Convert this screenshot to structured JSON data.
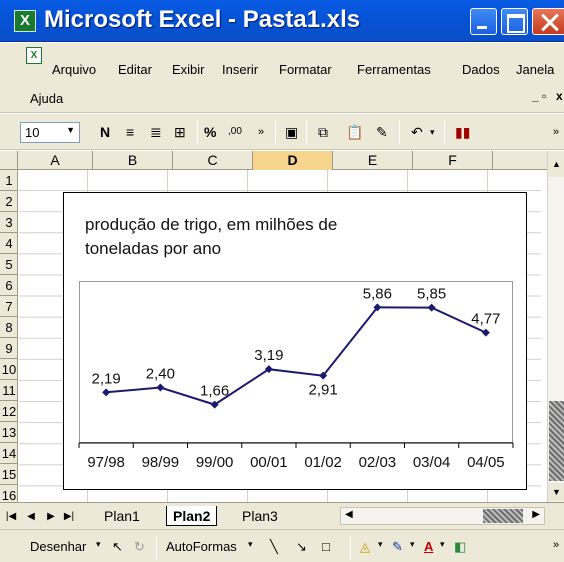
{
  "window": {
    "title": "Microsoft Excel - Pasta1.xls",
    "app_icon": "excel-logo-icon"
  },
  "menu": {
    "items": [
      "Arquivo",
      "Editar",
      "Exibir",
      "Inserir",
      "Formatar",
      "Ferramentas",
      "Dados",
      "Janela",
      "Ajuda"
    ]
  },
  "toolbar": {
    "font_size": "10",
    "bold": "N",
    "icons": [
      "align-left-icon",
      "align-center-icon",
      "merge-center-icon",
      "percent-icon",
      "increase-decimal-icon",
      "save-icon",
      "copy-icon",
      "paste-icon",
      "format-painter-icon",
      "undo-icon",
      "chart-wizard-icon"
    ],
    "percent": "%",
    "decimal": ",00"
  },
  "grid": {
    "columns": [
      "A",
      "B",
      "C",
      "D",
      "E",
      "F"
    ],
    "active_column": "D",
    "rows": [
      "1",
      "2",
      "3",
      "4",
      "5",
      "6",
      "7",
      "8",
      "9",
      "10",
      "11",
      "12",
      "13",
      "14",
      "15",
      "16"
    ]
  },
  "chart_data": {
    "type": "line",
    "title": "produção de trigo, em milhões de toneladas por ano",
    "categories": [
      "97/98",
      "98/99",
      "99/00",
      "00/01",
      "01/02",
      "02/03",
      "03/04",
      "04/05"
    ],
    "values": [
      2.19,
      2.4,
      1.66,
      3.19,
      2.91,
      5.86,
      5.85,
      4.77
    ],
    "data_labels": [
      "2,19",
      "2,40",
      "1,66",
      "3,19",
      "2,91",
      "5,86",
      "5,85",
      "4,77"
    ],
    "xlabel": "",
    "ylabel": "",
    "ylim": [
      0,
      7
    ],
    "grid": false,
    "legend": "none",
    "line_color": "#1a1a6e"
  },
  "sheets": {
    "tabs": [
      "Plan1",
      "Plan2",
      "Plan3"
    ],
    "active": "Plan2"
  },
  "drawing": {
    "draw_label": "Desenhar",
    "autoshapes_label": "AutoFormas"
  }
}
